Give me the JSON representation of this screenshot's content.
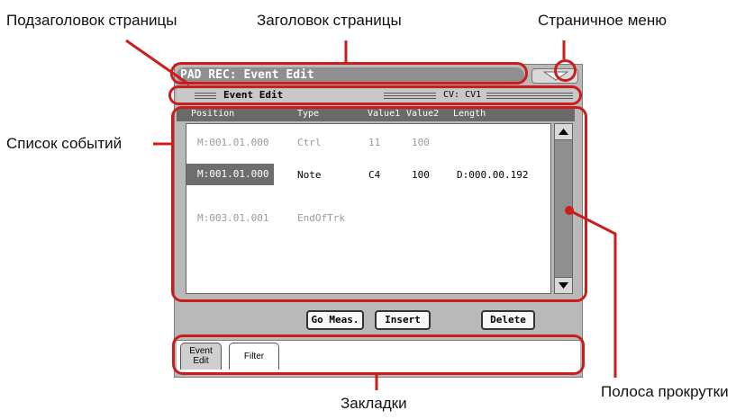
{
  "callouts": {
    "page_subtitle": "Подзаголовок страницы",
    "page_title": "Заголовок страницы",
    "page_menu": "Страничное меню",
    "event_list": "Список событий",
    "tabs": "Закладки",
    "scrollbar": "Полоса прокрутки"
  },
  "screen": {
    "title": "PAD REC: Event Edit",
    "menu_icon": "triangle-down-icon",
    "subtitle": "Event Edit",
    "cv": "CV: CV1",
    "columns": [
      "Position",
      "Type",
      "Value1",
      "Value2",
      "Length"
    ],
    "events": [
      {
        "position": "M:001.01.000",
        "type": "Ctrl",
        "value1": "11",
        "value2": "100",
        "length": "",
        "selected": false
      },
      {
        "position": "M:001.01.000",
        "type": "Note",
        "value1": "C4",
        "value2": "100",
        "length": "D:000.00.192",
        "selected": true
      },
      {
        "position": "M:003.01.001",
        "type": "EndOfTrk",
        "value1": "",
        "value2": "",
        "length": "",
        "selected": false
      }
    ],
    "buttons": {
      "go_meas": "Go Meas.",
      "insert": "Insert",
      "delete": "Delete"
    },
    "tabs": [
      {
        "label_line1": "Event",
        "label_line2": "Edit",
        "active": true
      },
      {
        "label_line1": "Filter",
        "label_line2": "",
        "active": false
      }
    ]
  },
  "colors": {
    "highlight": "#cc1d1d",
    "title_bar": "#8f8f8f",
    "selected_row": "#6e6e6e",
    "column_header": "#6a6a6a"
  }
}
